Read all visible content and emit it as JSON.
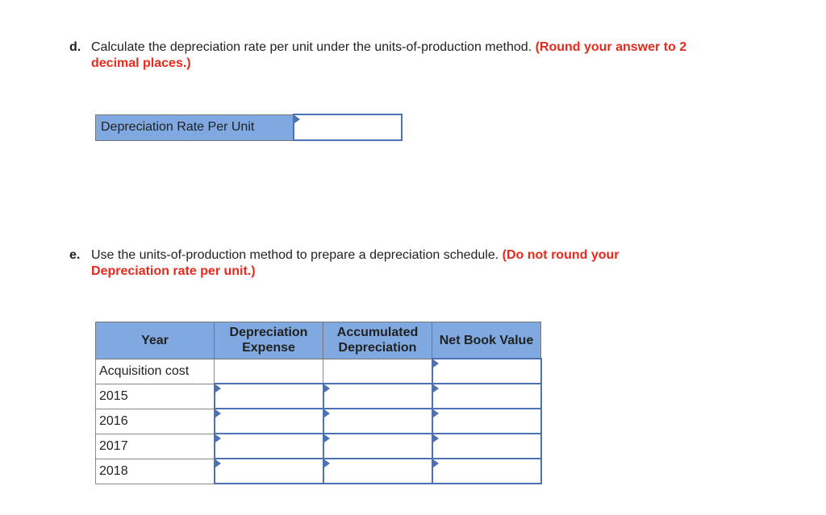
{
  "part_d": {
    "letter": "d.",
    "text": "Calculate the depreciation rate per unit under the units-of-production method.",
    "note_line1": "(Round your answer to 2",
    "note_line2": "decimal places.)",
    "table": {
      "label": "Depreciation Rate Per Unit",
      "value": ""
    }
  },
  "part_e": {
    "letter": "e.",
    "text": "Use the units-of-production method to prepare a depreciation schedule.",
    "note_line1": "(Do not round your",
    "note_line2": "Depreciation rate per unit.)",
    "table": {
      "headers": [
        "Year",
        "Depreciation Expense",
        "Accumulated Depreciation",
        "Net Book Value"
      ],
      "rows": [
        {
          "year": "Acquisition cost",
          "dep_expense": "",
          "acc_dep": "",
          "nbv": ""
        },
        {
          "year": "2015",
          "dep_expense": "",
          "acc_dep": "",
          "nbv": ""
        },
        {
          "year": "2016",
          "dep_expense": "",
          "acc_dep": "",
          "nbv": ""
        },
        {
          "year": "2017",
          "dep_expense": "",
          "acc_dep": "",
          "nbv": ""
        },
        {
          "year": "2018",
          "dep_expense": "",
          "acc_dep": "",
          "nbv": ""
        }
      ]
    }
  },
  "colors": {
    "header_bg": "#7fa9e0",
    "input_border": "#4d72b3",
    "note_red": "#e8291c"
  }
}
